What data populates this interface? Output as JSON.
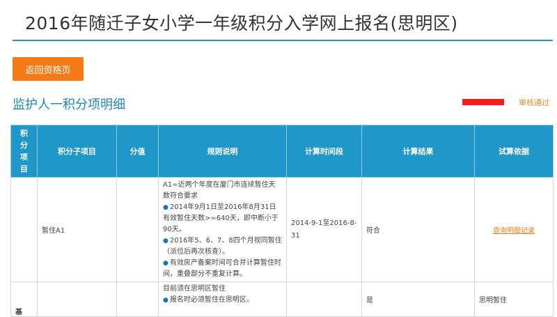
{
  "header": {
    "title": "2016年随迁子女小学一年级积分入学网上报名(思明区)"
  },
  "actions": {
    "back_label": "返回资格页"
  },
  "section": {
    "title": "监护人一积分项明细",
    "status": "审核通过"
  },
  "table": {
    "headers": [
      "积分项目",
      "积分子项目",
      "分值",
      "规则说明",
      "计算时间段",
      "计算结果",
      "试算依据"
    ],
    "rows": [
      {
        "category": "",
        "sub_item": "暂住A1",
        "score": "",
        "rules": [
          {
            "bullet": false,
            "text": "A1=近两个年度在厦门市连续暂住天数符合要求"
          },
          {
            "bullet": true,
            "text": "2014年9月1日至2016年8月31日有效暂住天数>=640天，即中断小于90天。"
          },
          {
            "bullet": true,
            "text": "2016年5、6、7、8四个月视同暂住（派位后再次核查）。"
          },
          {
            "bullet": true,
            "text": "有效房产备案时间可合并计算暂住时间，重叠部分不重复计算。"
          }
        ],
        "period": "2014-9-1至2016-8-31",
        "result": "符合",
        "basis": "查询明细记录"
      },
      {
        "category": "基",
        "sub_item": "",
        "score": "",
        "rules": [
          {
            "bullet": false,
            "text": "目前须在思明区暂住"
          },
          {
            "bullet": true,
            "text": "报名时必须暂住在思明区。"
          }
        ],
        "period": "",
        "result": "是",
        "basis": "思明暂住"
      }
    ]
  }
}
